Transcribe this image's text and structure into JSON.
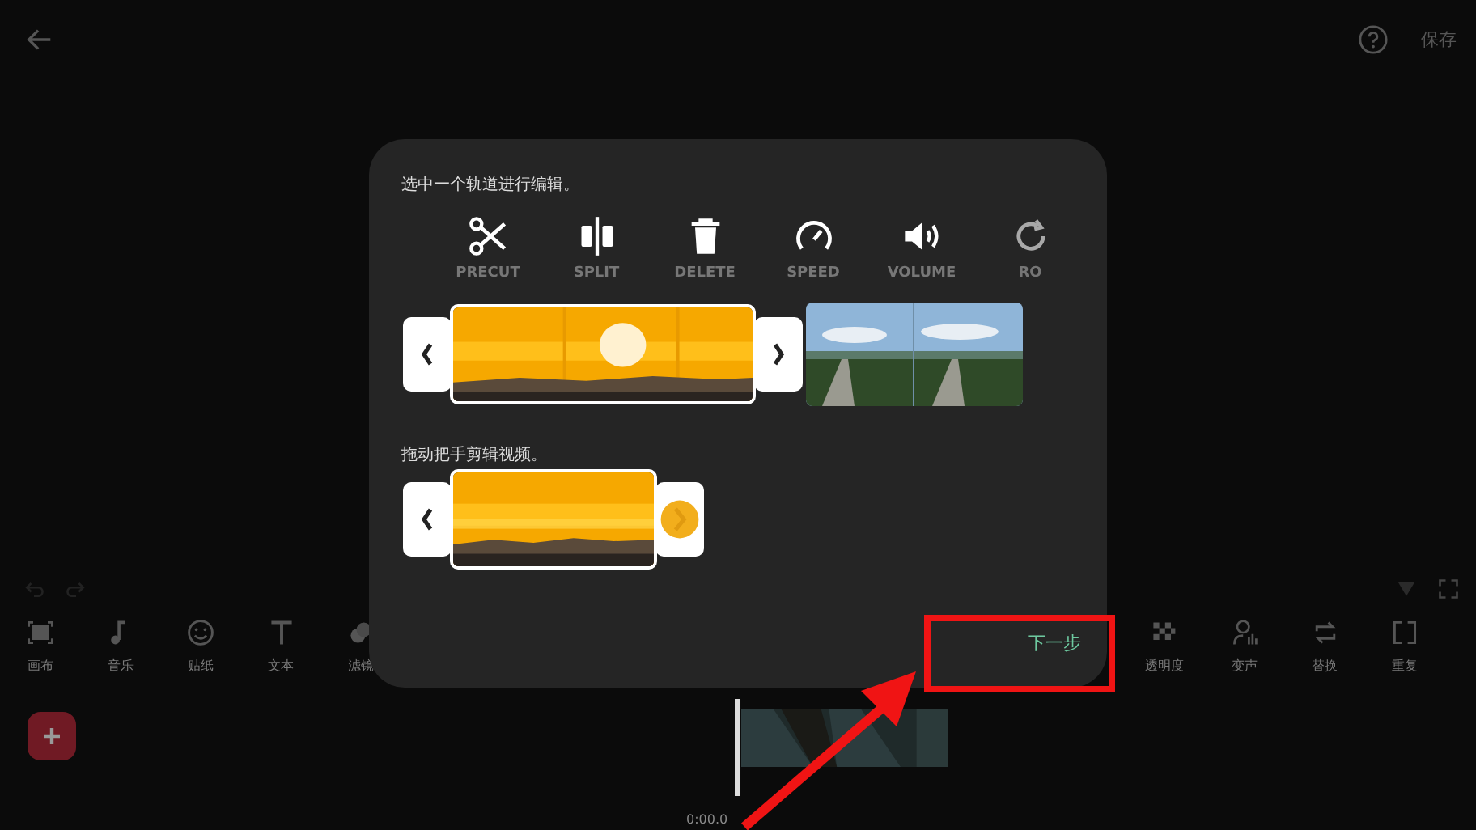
{
  "top_bar": {
    "save": "保存"
  },
  "toolbar": {
    "left": [
      {
        "kind": "canvas",
        "label": "画布"
      },
      {
        "kind": "music",
        "label": "音乐"
      },
      {
        "kind": "sticker",
        "label": "贴纸"
      },
      {
        "kind": "text",
        "label": "文本"
      },
      {
        "kind": "filter",
        "label": "滤镜"
      }
    ],
    "right": [
      {
        "kind": "opacity",
        "label": "透明度"
      },
      {
        "kind": "voice",
        "label": "变声"
      },
      {
        "kind": "replace",
        "label": "替换"
      },
      {
        "kind": "repeat",
        "label": "重复"
      }
    ]
  },
  "timeline": {
    "time": "0:00.0"
  },
  "dialog": {
    "hint_select": "选中一个轨道进行编辑。",
    "tools": [
      {
        "kind": "scissors",
        "label": "PRECUT",
        "faded": false
      },
      {
        "kind": "split",
        "label": "SPLIT",
        "faded": false
      },
      {
        "kind": "trash",
        "label": "DELETE",
        "faded": false
      },
      {
        "kind": "speed",
        "label": "SPEED",
        "faded": false
      },
      {
        "kind": "volume",
        "label": "VOLUME",
        "faded": false
      },
      {
        "kind": "rotate",
        "label": "RO",
        "faded": true
      }
    ],
    "hint_trim": "拖动把手剪辑视频。",
    "next": "下一步"
  }
}
